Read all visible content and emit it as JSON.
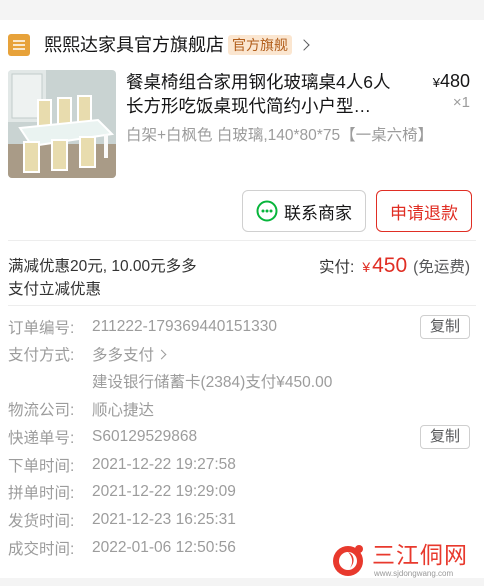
{
  "colors": {
    "accent": "#e02e24",
    "badge_bg": "#fbe6d0",
    "badge_text": "#b25e1b",
    "chat_green": "#07b53b",
    "store_logo": "#e7a23a"
  },
  "store": {
    "logo_icon": "store-logo-icon",
    "name": "熙熙达家具官方旗舰店",
    "badge": "官方旗舰",
    "chevron_icon": "chevron-right-icon"
  },
  "product": {
    "image": "dining-table-set-photo",
    "title": "餐桌椅组合家用钢化玻璃桌4人6人长方形吃饭桌现代简约小户型…",
    "price_symbol": "¥",
    "price": "480",
    "quantity": "×1",
    "spec": "白架+白枫色 白玻璃,140*80*75【一桌六椅】"
  },
  "actions": {
    "contact_icon": "chat-bubble-icon",
    "contact_label": "联系商家",
    "refund_label": "申请退款"
  },
  "payment_summary": {
    "discount_text": "满减优惠20元, 10.00元多多支付立减优惠",
    "paid_label": "实付:",
    "paid_symbol": "¥",
    "paid_amount": "450",
    "shipping_note": "(免运费)"
  },
  "order_info": [
    {
      "label": "订单编号:",
      "value": "211222-179369440151330",
      "action": "复制"
    },
    {
      "label": "支付方式:",
      "value": "多多支付",
      "sub_value": "建设银行储蓄卡(2384)支付¥450.00"
    },
    {
      "label": "物流公司:",
      "value": "顺心捷达"
    },
    {
      "label": "快递单号:",
      "value": "S60129529868",
      "action": "复制"
    },
    {
      "label": "下单时间:",
      "value": "2021-12-22 19:27:58"
    },
    {
      "label": "拼单时间:",
      "value": "2021-12-22 19:29:09"
    },
    {
      "label": "发货时间:",
      "value": "2021-12-23 16:25:31"
    },
    {
      "label": "成交时间:",
      "value": "2022-01-06 12:50:56"
    }
  ],
  "watermark": {
    "name": "三江侗网",
    "url": "www.sjdongwang.com"
  }
}
